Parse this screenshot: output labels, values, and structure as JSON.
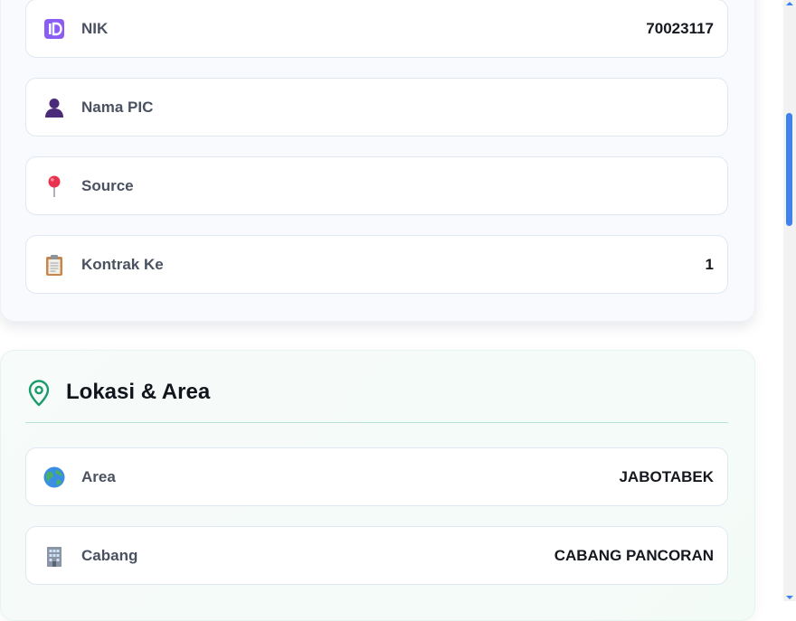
{
  "profile_rows": [
    {
      "label": "NIK",
      "value": "70023117",
      "icon": "id-badge-icon"
    },
    {
      "label": "Nama PIC",
      "value": "",
      "icon": "person-silhouette-icon"
    },
    {
      "label": "Source",
      "value": "",
      "icon": "pushpin-icon"
    },
    {
      "label": "Kontrak Ke",
      "value": "1",
      "icon": "clipboard-icon"
    }
  ],
  "location_section": {
    "title": "Lokasi & Area",
    "icon": "map-pin-outline-icon",
    "accent": "#1a9b6c",
    "rows": [
      {
        "label": "Area",
        "value": "JABOTABEK",
        "icon": "globe-icon"
      },
      {
        "label": "Cabang",
        "value": "CABANG PANCORAN",
        "icon": "office-building-icon"
      }
    ]
  },
  "colors": {
    "scrollbar_thumb": "#3f82ee",
    "label_text": "#4a5160",
    "value_text": "#15181e"
  }
}
